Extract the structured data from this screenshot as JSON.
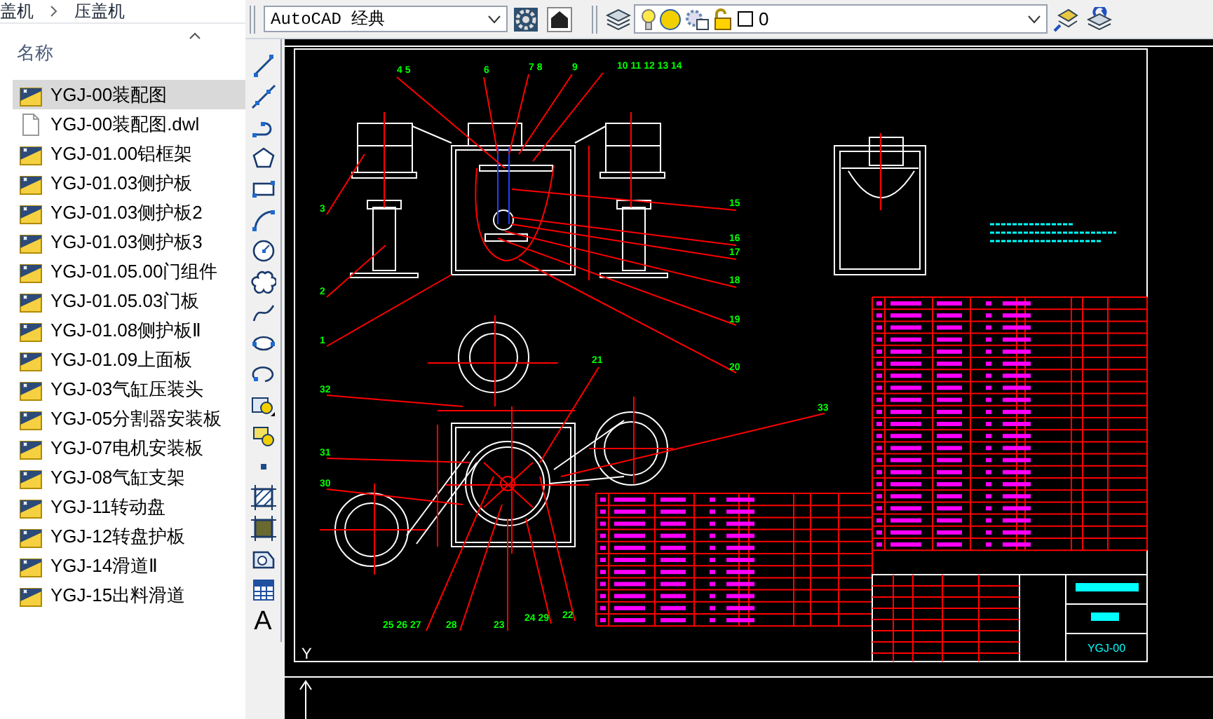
{
  "explorer": {
    "breadcrumb": [
      "盖机",
      "压盖机"
    ],
    "column_header": "名称",
    "files": [
      {
        "name": "YGJ-00装配图",
        "kind": "dwg",
        "selected": true
      },
      {
        "name": "YGJ-00装配图.dwl",
        "kind": "dwl",
        "selected": false
      },
      {
        "name": "YGJ-01.00铝框架",
        "kind": "dwg",
        "selected": false
      },
      {
        "name": "YGJ-01.03侧护板",
        "kind": "dwg",
        "selected": false
      },
      {
        "name": "YGJ-01.03侧护板2",
        "kind": "dwg",
        "selected": false
      },
      {
        "name": "YGJ-01.03侧护板3",
        "kind": "dwg",
        "selected": false
      },
      {
        "name": "YGJ-01.05.00门组件",
        "kind": "dwg",
        "selected": false
      },
      {
        "name": "YGJ-01.05.03门板",
        "kind": "dwg",
        "selected": false
      },
      {
        "name": "YGJ-01.08侧护板Ⅱ",
        "kind": "dwg",
        "selected": false
      },
      {
        "name": "YGJ-01.09上面板",
        "kind": "dwg",
        "selected": false
      },
      {
        "name": "YGJ-03气缸压装头",
        "kind": "dwg",
        "selected": false
      },
      {
        "name": "YGJ-05分割器安装板",
        "kind": "dwg",
        "selected": false
      },
      {
        "name": "YGJ-07电机安装板",
        "kind": "dwg",
        "selected": false
      },
      {
        "name": "YGJ-08气缸支架",
        "kind": "dwg",
        "selected": false
      },
      {
        "name": "YGJ-11转动盘",
        "kind": "dwg",
        "selected": false
      },
      {
        "name": "YGJ-12转盘护板",
        "kind": "dwg",
        "selected": false
      },
      {
        "name": "YGJ-14滑道Ⅱ",
        "kind": "dwg",
        "selected": false
      },
      {
        "name": "YGJ-15出料滑道",
        "kind": "dwg",
        "selected": false
      }
    ]
  },
  "toolbar": {
    "workspace": "AutoCAD 经典",
    "layer": "0"
  },
  "draw_tools": [
    {
      "kind": "line"
    },
    {
      "kind": "xline"
    },
    {
      "kind": "polyline"
    },
    {
      "kind": "polygon"
    },
    {
      "kind": "rectangle"
    },
    {
      "kind": "arc"
    },
    {
      "kind": "circle"
    },
    {
      "kind": "cloud"
    },
    {
      "kind": "spline"
    },
    {
      "kind": "ellipse"
    },
    {
      "kind": "ellipse-arc"
    },
    {
      "kind": "insert"
    },
    {
      "kind": "block"
    },
    {
      "kind": "point"
    },
    {
      "kind": "hatch"
    },
    {
      "kind": "gradient"
    },
    {
      "kind": "region"
    },
    {
      "kind": "table"
    },
    {
      "kind": "text",
      "label": "A"
    }
  ],
  "drawing": {
    "balloons": [
      "4 5",
      "6",
      "7 8",
      "9",
      "10 11 12 13 14",
      "15",
      "16",
      "17",
      "18",
      "19",
      "20",
      "3",
      "2",
      "1",
      "21",
      "32",
      "31",
      "30",
      "33",
      "25 26 27",
      "28",
      "23",
      "24 29",
      "22"
    ],
    "drawing_number": "YGJ-00",
    "ucs_label": "Y"
  }
}
